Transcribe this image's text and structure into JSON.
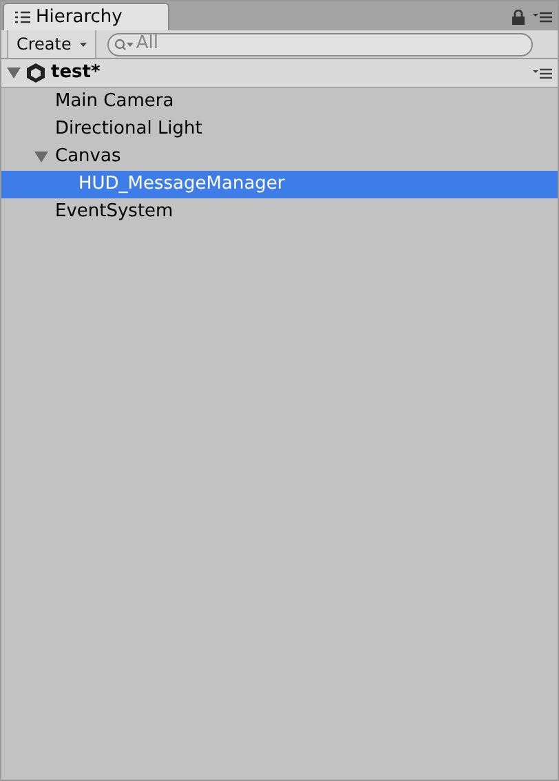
{
  "tab": {
    "title": "Hierarchy"
  },
  "toolbar": {
    "create_label": "Create",
    "search": {
      "placeholder": "All"
    }
  },
  "scene": {
    "name": "test*",
    "expanded": true,
    "children": [
      {
        "name": "Main Camera",
        "selected": false
      },
      {
        "name": "Directional Light",
        "selected": false
      },
      {
        "name": "Canvas",
        "selected": false,
        "expanded": true,
        "children": [
          {
            "name": "HUD_MessageManager",
            "selected": true
          }
        ]
      },
      {
        "name": "EventSystem",
        "selected": false
      }
    ]
  }
}
